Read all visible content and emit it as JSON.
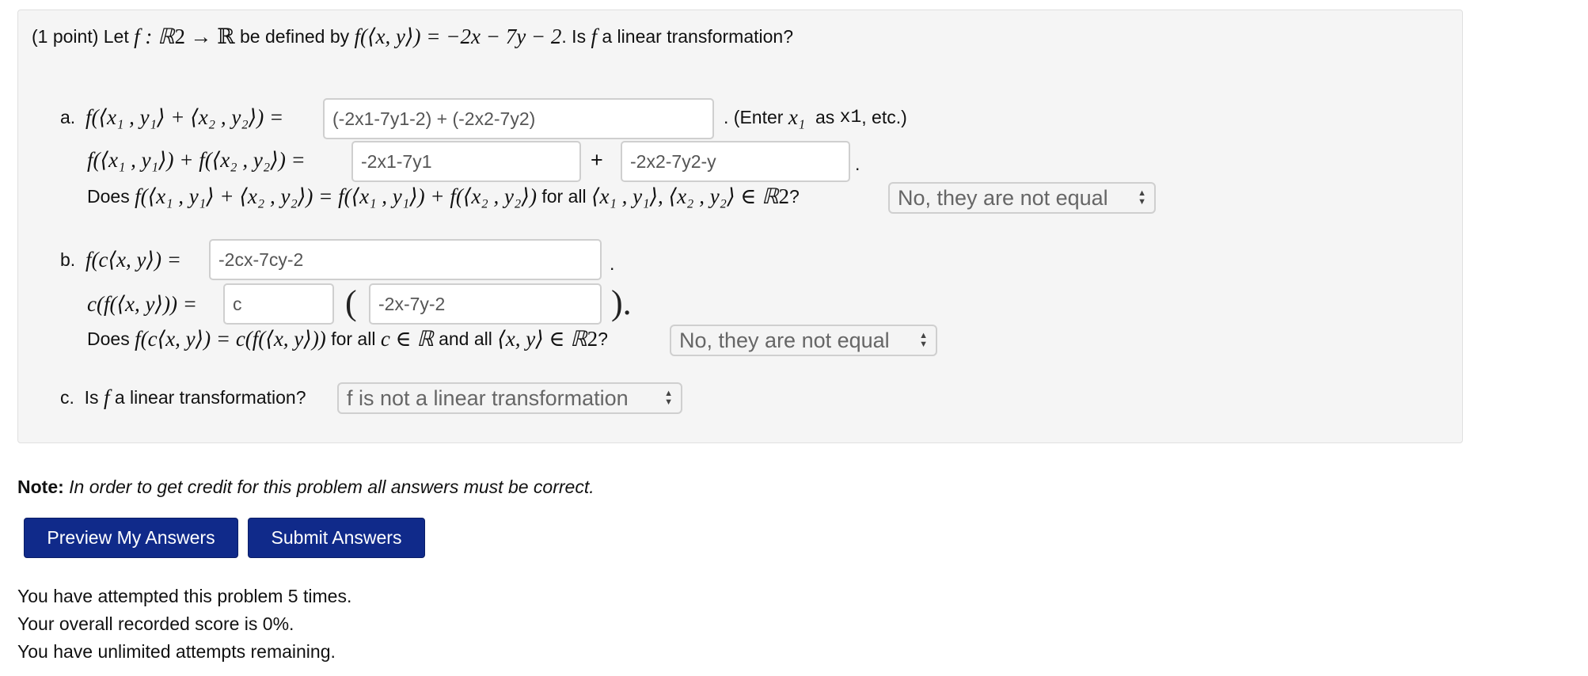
{
  "problem": {
    "point_label": "(1 point)",
    "intro_let": "Let",
    "intro_fsig": "f : ℝ",
    "intro_exp": "2",
    "intro_arrow": "→ ℝ",
    "intro_defined": "be defined by",
    "intro_formula": "f(⟨x, y⟩) = −2x − 7y − 2",
    "intro_question_a": ". Is",
    "intro_f": "f",
    "intro_question_b": "a linear transformation?"
  },
  "part_a": {
    "label": "a.",
    "lhs1": "f(⟨x₁ , y₁⟩ + ⟨x₂ , y₂⟩) =",
    "answer1": "(-2x1-7y1-2) + (-2x2-7y2)",
    "enter_hint_pre": ". (Enter",
    "enter_hint_var": "x₁",
    "enter_hint_as": "as",
    "enter_hint_code": "x1",
    "enter_hint_post": ", etc.)",
    "lhs2": "f(⟨x₁ , y₁⟩) + f(⟨x₂ , y₂⟩) =",
    "answer2a": "-2x1-7y1",
    "plus": "+",
    "answer2b": "-2x2-7y2-y",
    "period": ".",
    "does": "Does",
    "eq_question": "f(⟨x₁ , y₁⟩ + ⟨x₂ , y₂⟩) = f(⟨x₁ , y₁⟩) + f(⟨x₂ , y₂⟩)",
    "for_all": "for all",
    "pairs": "⟨x₁ , y₁⟩, ⟨x₂ , y₂⟩ ∈ ℝ",
    "exp": "2",
    "qmark": "?",
    "select": "No, they are not equal"
  },
  "part_b": {
    "label": "b.",
    "lhs1": "f(c⟨x, y⟩) =",
    "answer1": "-2cx-7cy-2",
    "period": ".",
    "lhs2": "c(f(⟨x, y⟩)) =",
    "answer2a": "c",
    "open_paren": "(",
    "answer2b": "-2x-7y-2",
    "close_paren": ").",
    "does": "Does",
    "eq_question": "f(c⟨x, y⟩) = c(f(⟨x, y⟩))",
    "for_all": "for all",
    "c_in": "c ∈ ℝ",
    "and_all": "and all",
    "pair": "⟨x, y⟩ ∈ ℝ",
    "exp": "2",
    "qmark": "?",
    "select": "No, they are not equal"
  },
  "part_c": {
    "label": "c.",
    "question_pre": "Is",
    "f": "f",
    "question_post": "a linear transformation?",
    "select": "f is not a linear transformation"
  },
  "note": {
    "bold": "Note:",
    "text": "In order to get credit for this problem all answers must be correct."
  },
  "buttons": {
    "preview": "Preview My Answers",
    "submit": "Submit Answers"
  },
  "status": {
    "attempts": "You have attempted this problem 5 times.",
    "score": "Your overall recorded score is 0%.",
    "remaining": "You have unlimited attempts remaining."
  },
  "colors": {
    "button_bg": "#102a8a",
    "panel_bg": "#f5f5f5"
  }
}
